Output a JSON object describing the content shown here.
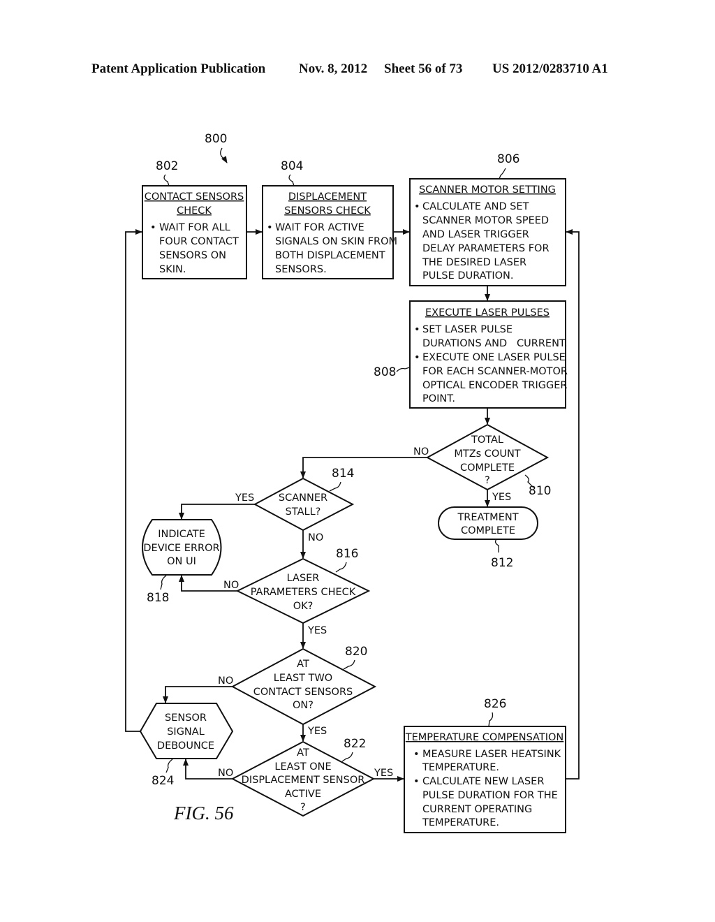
{
  "header": {
    "publication": "Patent Application Publication",
    "date": "Nov. 8, 2012",
    "sheet": "Sheet 56 of 73",
    "number": "US 2012/0283710 A1"
  },
  "figure": {
    "label": "FIG. 56",
    "ref": "800"
  },
  "nodes": {
    "n802": {
      "ref": "802",
      "title": [
        "CONTACT SENSORS",
        "CHECK"
      ],
      "lines": [
        "WAIT FOR ALL",
        "FOUR CONTACT",
        "SENSORS ON",
        "SKIN."
      ]
    },
    "n804": {
      "ref": "804",
      "title": [
        "DISPLACEMENT",
        "SENSORS CHECK"
      ],
      "lines": [
        "WAIT FOR ACTIVE",
        "SIGNALS ON SKIN FROM",
        "BOTH DISPLACEMENT",
        "SENSORS."
      ]
    },
    "n806": {
      "ref": "806",
      "title": [
        "SCANNER MOTOR SETTING"
      ],
      "lines": [
        "CALCULATE AND SET",
        "SCANNER MOTOR SPEED",
        "AND LASER TRIGGER",
        "DELAY PARAMETERS FOR",
        "THE DESIRED LASER",
        "PULSE DURATION."
      ]
    },
    "n808": {
      "ref": "808",
      "title": [
        "EXECUTE LASER PULSES"
      ],
      "lines": [
        "SET LASER PULSE",
        "DURATIONS AND   CURRENT.",
        "EXECUTE ONE LASER PULSE",
        "FOR EACH SCANNER-MOTOR",
        "OPTICAL ENCODER TRIGGER",
        "POINT."
      ]
    },
    "n810": {
      "ref": "810",
      "lines": [
        "TOTAL",
        "MTZs COUNT",
        "COMPLETE",
        "?"
      ]
    },
    "n812": {
      "ref": "812",
      "lines": [
        "TREATMENT",
        "COMPLETE"
      ]
    },
    "n814": {
      "ref": "814",
      "lines": [
        "SCANNER",
        "STALL?"
      ]
    },
    "n816": {
      "ref": "816",
      "lines": [
        "LASER",
        "PARAMETERS CHECK",
        "OK?"
      ]
    },
    "n818": {
      "ref": "818",
      "lines": [
        "INDICATE",
        "DEVICE ERROR",
        "ON UI"
      ]
    },
    "n820": {
      "ref": "820",
      "lines": [
        "AT",
        "LEAST TWO",
        "CONTACT SENSORS",
        "ON?"
      ]
    },
    "n822": {
      "ref": "822",
      "lines": [
        "AT",
        "LEAST ONE",
        "DISPLACEMENT SENSOR",
        "ACTIVE",
        "?"
      ]
    },
    "n824": {
      "ref": "824",
      "lines": [
        "SENSOR",
        "SIGNAL",
        "DEBOUNCE"
      ]
    },
    "n826": {
      "ref": "826",
      "title": [
        "TEMPERATURE COMPENSATION"
      ],
      "lines": [
        "MEASURE LASER HEATSINK",
        "TEMPERATURE.",
        "CALCULATE NEW LASER",
        "PULSE DURATION FOR THE",
        "CURRENT OPERATING",
        "TEMPERATURE."
      ]
    }
  },
  "edge_labels": {
    "yes": "YES",
    "no": "NO"
  },
  "bullet": "•"
}
